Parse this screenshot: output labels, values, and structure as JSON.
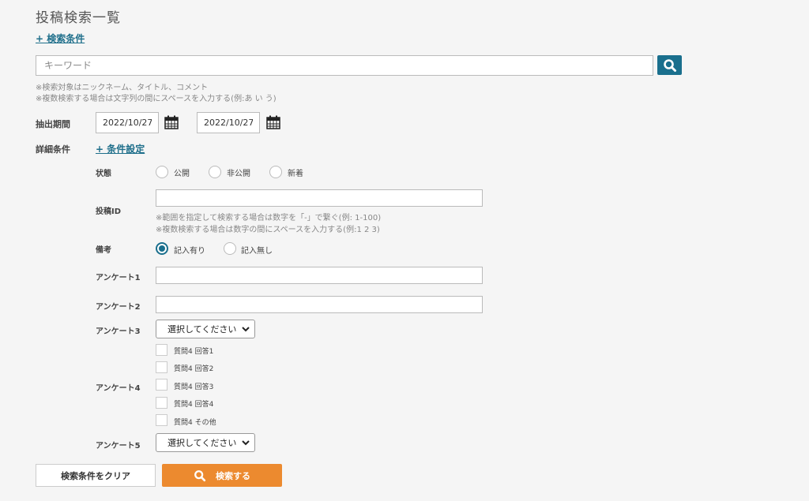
{
  "page": {
    "title": "投稿検索一覧"
  },
  "search_conditions_toggle": "+ 検索条件",
  "keyword": {
    "placeholder": "キーワード",
    "value": ""
  },
  "notes": {
    "line1": "※検索対象はニックネーム、タイトル、コメント",
    "line2": "※複数検索する場合は文字列の間にスペースを入力する(例:あ い う)"
  },
  "period": {
    "label": "抽出期間",
    "start": "2022/10/27",
    "end": "2022/10/27"
  },
  "detail": {
    "label": "詳細条件",
    "toggle": "+ 条件設定"
  },
  "status": {
    "label": "状態",
    "options": [
      "公開",
      "非公開",
      "新着"
    ]
  },
  "post_id": {
    "label": "投稿ID",
    "value": "",
    "note1": "※範囲を指定して検索する場合は数字を「-」で繋ぐ(例: 1-100)",
    "note2": "※複数検索する場合は数字の間にスペースを入力する(例:1 2 3)"
  },
  "remarks": {
    "label": "備考",
    "options": [
      "記入有り",
      "記入無し"
    ],
    "selected": "記入有り"
  },
  "survey1": {
    "label": "アンケート1",
    "value": ""
  },
  "survey2": {
    "label": "アンケート2",
    "value": ""
  },
  "survey3": {
    "label": "アンケート3",
    "selected": "選択してください"
  },
  "survey4": {
    "label": "アンケート4",
    "checkboxes": [
      "質問4 回答1",
      "質問4 回答2",
      "質問4 回答3",
      "質問4 回答4",
      "質問4 その他"
    ]
  },
  "survey5": {
    "label": "アンケート5",
    "selected": "選択してください"
  },
  "buttons": {
    "clear": "検索条件をクリア",
    "search": "検索する"
  },
  "colors": {
    "accent": "#1a6f8d",
    "search_button": "#ec8a2f",
    "link": "#1f6f8b"
  }
}
